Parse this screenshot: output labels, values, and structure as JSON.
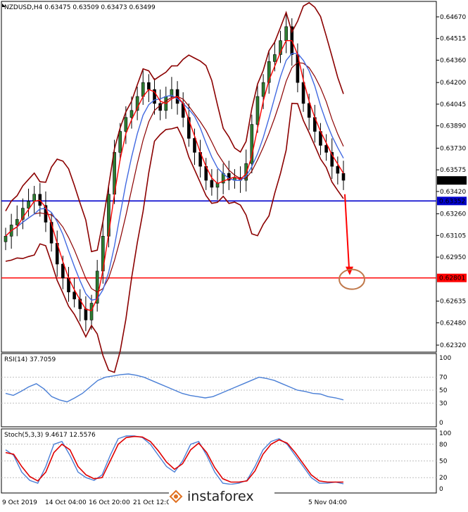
{
  "chart_data": [
    {
      "type": "candlestick",
      "title": "NZDUSD,H4  0.63475 0.63509 0.63473 0.63499",
      "price_ticks": [
        "0.64670",
        "0.64515",
        "0.64360",
        "0.64200",
        "0.64045",
        "0.63890",
        "0.63730",
        "0.63575",
        "0.63420",
        "0.63260",
        "0.63105",
        "0.62950",
        "0.62635",
        "0.62480",
        "0.62320"
      ],
      "ylim": [
        0.623,
        0.647
      ],
      "current_price": "0.63499",
      "levels": [
        {
          "label": "0.63352",
          "value": 0.63352,
          "color": "#0000cc"
        },
        {
          "label": "0.62801",
          "value": 0.62801,
          "color": "#ff0000"
        }
      ],
      "x_labels": [
        "9 Oct 2019",
        "14 Oct 04:00",
        "16 Oct 20:00",
        "21 Oct 12:00",
        "5 Nov 04:00"
      ],
      "close_series": [
        0.631,
        0.6318,
        0.6322,
        0.633,
        0.6335,
        0.634,
        0.6332,
        0.632,
        0.6305,
        0.629,
        0.628,
        0.627,
        0.6265,
        0.6258,
        0.625,
        0.6262,
        0.6285,
        0.631,
        0.634,
        0.637,
        0.6385,
        0.6395,
        0.64,
        0.641,
        0.642,
        0.6415,
        0.6405,
        0.64,
        0.641,
        0.6415,
        0.6405,
        0.6395,
        0.638,
        0.637,
        0.636,
        0.635,
        0.6345,
        0.6348,
        0.6355,
        0.635,
        0.6352,
        0.635,
        0.6362,
        0.639,
        0.641,
        0.642,
        0.6435,
        0.644,
        0.645,
        0.646,
        0.644,
        0.642,
        0.6405,
        0.6395,
        0.6385,
        0.6375,
        0.637,
        0.636,
        0.6355,
        0.635
      ],
      "overlays": [
        {
          "name": "MA fast",
          "color": "#ff0000"
        },
        {
          "name": "MA slow",
          "color": "#4169e1"
        },
        {
          "name": "Bollinger",
          "color": "#8b0000"
        }
      ],
      "annotation": {
        "type": "arrow-down",
        "target": 0.62801,
        "color": "#ff0000"
      }
    },
    {
      "type": "line",
      "title": "RSI(14) 37.7059",
      "ylim": [
        0,
        100
      ],
      "ticks": [
        "100",
        "70",
        "50",
        "30",
        "0"
      ],
      "levels": [
        70,
        50,
        30
      ],
      "values": [
        45,
        42,
        48,
        55,
        60,
        52,
        40,
        35,
        32,
        38,
        45,
        55,
        65,
        70,
        72,
        74,
        75,
        73,
        70,
        65,
        60,
        55,
        50,
        45,
        42,
        40,
        38,
        40,
        45,
        50,
        55,
        60,
        65,
        70,
        68,
        65,
        60,
        55,
        50,
        48,
        45,
        44,
        40,
        38,
        35
      ]
    },
    {
      "type": "line",
      "title": "Stoch(5,3,3) 9.4617 12.5576",
      "ylim": [
        0,
        100
      ],
      "ticks": [
        "100",
        "80",
        "50",
        "20",
        "0"
      ],
      "levels": [
        80,
        50,
        20
      ],
      "main": [
        70,
        60,
        30,
        15,
        10,
        40,
        80,
        85,
        60,
        30,
        20,
        15,
        25,
        60,
        90,
        95,
        95,
        92,
        80,
        60,
        40,
        30,
        50,
        80,
        85,
        60,
        30,
        10,
        8,
        10,
        15,
        40,
        70,
        85,
        90,
        80,
        60,
        40,
        20,
        10,
        10,
        12,
        9
      ],
      "signal": [
        65,
        62,
        40,
        22,
        14,
        30,
        65,
        80,
        70,
        40,
        25,
        18,
        20,
        50,
        80,
        92,
        94,
        93,
        85,
        68,
        48,
        35,
        45,
        70,
        82,
        65,
        38,
        18,
        12,
        12,
        14,
        32,
        62,
        80,
        88,
        82,
        65,
        45,
        25,
        14,
        12,
        12,
        12
      ]
    }
  ],
  "watermark": {
    "text": "instaforex"
  }
}
